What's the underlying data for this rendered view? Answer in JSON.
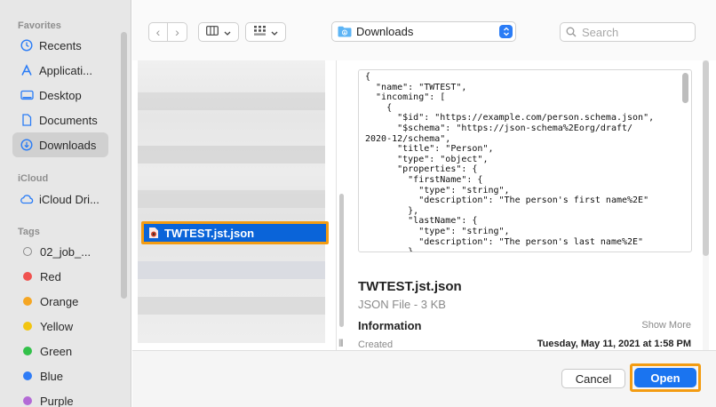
{
  "sidebar": {
    "favorites_heading": "Favorites",
    "favorites": [
      {
        "label": "Recents",
        "icon": "clock-icon"
      },
      {
        "label": "Applicati...",
        "icon": "applications-icon"
      },
      {
        "label": "Desktop",
        "icon": "desktop-icon"
      },
      {
        "label": "Documents",
        "icon": "document-icon"
      },
      {
        "label": "Downloads",
        "icon": "download-icon",
        "selected": true
      }
    ],
    "icloud_heading": "iCloud",
    "icloud": [
      {
        "label": "iCloud Dri...",
        "icon": "cloud-icon"
      }
    ],
    "tags_heading": "Tags",
    "tags": [
      {
        "label": "02_job_...",
        "color": "none"
      },
      {
        "label": "Red",
        "color": "#f0524f"
      },
      {
        "label": "Orange",
        "color": "#f5a623"
      },
      {
        "label": "Yellow",
        "color": "#f2c511"
      },
      {
        "label": "Green",
        "color": "#33c14a"
      },
      {
        "label": "Blue",
        "color": "#2f7cf6"
      },
      {
        "label": "Purple",
        "color": "#b36ad6"
      }
    ]
  },
  "toolbar": {
    "location": "Downloads",
    "search_placeholder": "Search"
  },
  "file_list": {
    "selected_file": "TWTEST.jst.json"
  },
  "preview": {
    "code": "{\n  \"name\": \"TWTEST\",\n  \"incoming\": [\n    {\n      \"$id\": \"https://example.com/person.schema.json\",\n      \"$schema\": \"https://json-schema%2Eorg/draft/\n2020-12/schema\",\n      \"title\": \"Person\",\n      \"type\": \"object\",\n      \"properties\": {\n        \"firstName\": {\n          \"type\": \"string\",\n          \"description\": \"The person's first name%2E\"\n        },\n        \"lastName\": {\n          \"type\": \"string\",\n          \"description\": \"The person's last name%2E\"\n        },\n        \"age\": {",
    "title": "TWTEST.jst.json",
    "subtitle": "JSON File - 3 KB",
    "info_heading": "Information",
    "show_more": "Show More",
    "created_label": "Created",
    "created_value": "Tuesday, May 11, 2021 at 1:58 PM"
  },
  "buttons": {
    "cancel": "Cancel",
    "open": "Open"
  },
  "colors": {
    "accent": "#1a74f0",
    "highlight": "#f39c12",
    "selection": "#0a64d9"
  }
}
